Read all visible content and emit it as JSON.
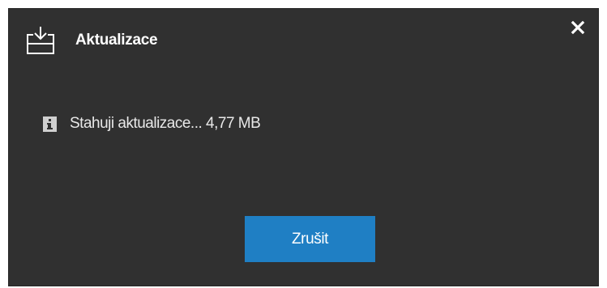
{
  "dialog": {
    "title": "Aktualizace",
    "title_icon": "download-icon",
    "close_icon": "close-icon",
    "message": {
      "icon": "info-icon",
      "text": "Stahuji aktualizace... 4,77 MB"
    },
    "cancel_label": "Zrušit"
  },
  "colors": {
    "dialog_background": "#303030",
    "button_accent": "#1f7fc4",
    "text": "#ffffff"
  }
}
